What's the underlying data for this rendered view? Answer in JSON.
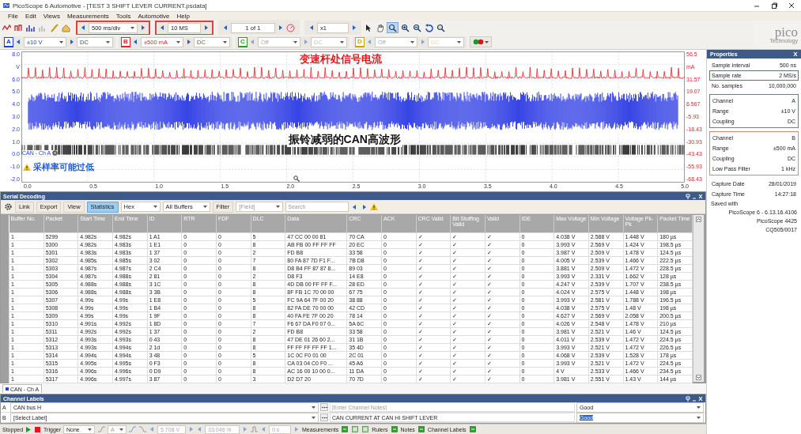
{
  "window": {
    "title": "PicoScope 6 Automotive - [TEST 3 SHIFT LEVER CURRENT.psdata]"
  },
  "menu": [
    "File",
    "Edit",
    "Views",
    "Measurements",
    "Tools",
    "Automotive",
    "Help"
  ],
  "toolbar": {
    "timebase": {
      "value": "500 ms/div",
      "highlighted": true
    },
    "samples": {
      "value": "10 MS",
      "highlighted": true
    },
    "buffer": {
      "value": "1 of 1",
      "highlighted": false
    },
    "zoom": {
      "value": "x1",
      "highlighted": false
    }
  },
  "logo": {
    "name": "pico",
    "tagline": "Technology"
  },
  "channels": [
    {
      "label": "A",
      "color": "#1f3fd6",
      "range": "±10 V",
      "coupling": "DC",
      "disabled": false
    },
    {
      "label": "B",
      "color": "#e0262b",
      "range": "±500 mA",
      "coupling": "DC",
      "disabled": false
    },
    {
      "label": "C",
      "color": "#2a9d2a",
      "range": "Off",
      "coupling": "DC",
      "disabled": true
    },
    {
      "label": "D",
      "color": "#c8a800",
      "range": "Off",
      "coupling": "DC",
      "disabled": true
    }
  ],
  "chart": {
    "left_axis": [
      "8.0",
      "V",
      "6.0",
      "5.0",
      "4.0",
      "3.0",
      "2.0",
      "1.0",
      "0.0",
      "-1.0",
      "-2.0"
    ],
    "right_axis": [
      "56.5",
      "mA",
      "31.57",
      "19.07",
      "6.567",
      "-5.93",
      "-18.43",
      "-30.93",
      "-43.43",
      "-55.93",
      "-68.43"
    ],
    "x_axis": [
      "0.0",
      "0.5",
      "1.0",
      "1.5",
      "2.0",
      "2.5",
      "3.0",
      "3.5",
      "4.0",
      "4.5",
      "5.0"
    ],
    "annotations": [
      {
        "kind": "current",
        "text": "变速杆处信号电流"
      },
      {
        "kind": "can-high",
        "text": "振铃减弱的CAN高波形"
      },
      {
        "kind": "warning",
        "text": "采样率可能过低"
      }
    ],
    "decoder_label": "CAN - Ch A"
  },
  "properties": {
    "title": "Properties",
    "general": [
      {
        "label": "Sample interval",
        "value": "500 ns",
        "highlighted": false
      },
      {
        "label": "Sample rate",
        "value": "2 MS/s",
        "highlighted": true
      },
      {
        "label": "No. samples",
        "value": "10,000,000",
        "highlighted": false
      }
    ],
    "channel_groups": [
      {
        "color": "#6b6bf0",
        "rows": [
          {
            "label": "Channel",
            "value": "A"
          },
          {
            "label": "Range",
            "value": "±10 V"
          },
          {
            "label": "Coupling",
            "value": "DC"
          }
        ]
      },
      {
        "color": "#f08080",
        "rows": [
          {
            "label": "Channel",
            "value": "B"
          },
          {
            "label": "Range",
            "value": "±500 mA"
          },
          {
            "label": "Coupling",
            "value": "DC"
          },
          {
            "label": "Low Pass Filter",
            "value": "1 kHz"
          }
        ]
      }
    ],
    "capture": [
      {
        "label": "Capture Date",
        "value": "28/01/2019"
      },
      {
        "label": "Capture Time",
        "value": "14:27:18"
      }
    ],
    "saved_with_label": "Saved with",
    "saved_with": [
      "PicoScope 6 - 6.13.16.4106",
      "PicoScope 4425",
      "CQ505/0017"
    ]
  },
  "serial_decoding": {
    "title": "Serial Decoding",
    "buttons": [
      {
        "label": "Link",
        "selected": false
      },
      {
        "label": "Export",
        "selected": false
      },
      {
        "label": "View",
        "selected": false
      },
      {
        "label": "Statistics",
        "selected": true
      }
    ],
    "format": "Hex",
    "buffers": "All Buffers",
    "filter": "Filter",
    "field_placeholder": "[Field]",
    "search_placeholder": "Search",
    "columns": [
      "Buffer No.",
      "Packet",
      "Start Time",
      "End Time",
      "ID",
      "RTR",
      "FDF",
      "DLC",
      "Data",
      "CRC",
      "ACK",
      "CRC Valid",
      "Bit Stuffing Valid",
      "Valid",
      "IDE",
      "Max Voltage",
      "Min Voltage",
      "Voltage Pk-Pk",
      "Packet Time"
    ],
    "rows": [
      {
        "cells": [
          "1",
          "5299",
          "4.982s",
          "4.982s",
          "1 A1",
          "0",
          "0",
          "5",
          "47 CC 00 00 81",
          "70 CA",
          "0",
          "✓",
          "✓",
          "✓",
          "0",
          "4.038 V",
          "2.588 V",
          "1.448 V",
          "180 µs"
        ]
      },
      {
        "cells": [
          "1",
          "5300",
          "4.982s",
          "4.983s",
          "1 E1",
          "0",
          "0",
          "8",
          "AB FB 00 FF FF FF",
          "20 EC",
          "0",
          "✓",
          "✓",
          "✓",
          "0",
          "3.993 V",
          "2.569 V",
          "1.424 V",
          "198.5 µs"
        ]
      },
      {
        "cells": [
          "1",
          "5301",
          "4.983s",
          "4.983s",
          "1 37",
          "0",
          "0",
          "2",
          "FD B8",
          "33 58",
          "0",
          "✓",
          "✓",
          "✓",
          "0",
          "3.987 V",
          "2.509 V",
          "1.478 V",
          "124.5 µs"
        ]
      },
      {
        "cells": [
          "1",
          "5302",
          "4.985s",
          "4.985s",
          "3 02",
          "0",
          "0",
          "7",
          "80 FA 87 7D F1 F...",
          "7B D8",
          "0",
          "✓",
          "✓",
          "✓",
          "0",
          "4.005 V",
          "2.539 V",
          "1.466 V",
          "222.5 µs"
        ]
      },
      {
        "cells": [
          "1",
          "5303",
          "4.987s",
          "4.987s",
          "2 C4",
          "0",
          "0",
          "8",
          "D8 B4 FF 87 87 8...",
          "89 03",
          "0",
          "✓",
          "✓",
          "✓",
          "0",
          "3.881 V",
          "2.509 V",
          "1.472 V",
          "228.5 µs"
        ]
      },
      {
        "cells": [
          "1",
          "5304",
          "4.987s",
          "4.988s",
          "2 81",
          "0",
          "0",
          "2",
          "D8 F3",
          "14 E8",
          "0",
          "✓",
          "✓",
          "✓",
          "0",
          "3.993 V",
          "2.331 V",
          "1.662 V",
          "128 µs"
        ]
      },
      {
        "cells": [
          "1",
          "5305",
          "4.988s",
          "4.988s",
          "3 1C",
          "0",
          "0",
          "8",
          "4D DB 00 FF FF F...",
          "28 ED",
          "0",
          "✓",
          "✓",
          "✓",
          "0",
          "4.247 V",
          "2.539 V",
          "1.707 V",
          "238.5 µs"
        ]
      },
      {
        "cells": [
          "1",
          "5306",
          "4.988s",
          "4.988s",
          "3 3B",
          "0",
          "0",
          "8",
          "8F FB 1C 70 00 00",
          "67 75",
          "0",
          "✓",
          "✓",
          "✓",
          "0",
          "4.024 V",
          "2.575 V",
          "1.448 V",
          "198 µs"
        ]
      },
      {
        "cells": [
          "1",
          "5307",
          "4.99s",
          "4.99s",
          "1 E8",
          "0",
          "0",
          "5",
          "FC 9A 64 7F 00 20",
          "38 88",
          "0",
          "✓",
          "✓",
          "✓",
          "0",
          "3.993 V",
          "2.581 V",
          "1.788 V",
          "196.5 µs"
        ]
      },
      {
        "cells": [
          "1",
          "5308",
          "4.99s",
          "4.99s",
          "1 B4",
          "0",
          "0",
          "8",
          "82 FA DE 70 00 00",
          "42 CD",
          "0",
          "✓",
          "✓",
          "✓",
          "0",
          "4.038 V",
          "2.575 V",
          "1.48 V",
          "198 µs"
        ]
      },
      {
        "cells": [
          "1",
          "5309",
          "4.99s",
          "4.99s",
          "1 9F",
          "0",
          "0",
          "8",
          "40 FA FE 7F 00 20",
          "78 14",
          "0",
          "✓",
          "✓",
          "✓",
          "0",
          "4.627 V",
          "2.569 V",
          "2.058 V",
          "200.5 µs"
        ]
      },
      {
        "cells": [
          "1",
          "5310",
          "4.991s",
          "4.992s",
          "1 8D",
          "0",
          "0",
          "7",
          "F6 67 DA F0 07 0...",
          "5A 6C",
          "0",
          "✓",
          "✓",
          "✓",
          "0",
          "4.026 V",
          "2.548 V",
          "1.478 V",
          "210 µs"
        ]
      },
      {
        "cells": [
          "1",
          "5311",
          "4.992s",
          "4.992s",
          "1 37",
          "0",
          "0",
          "2",
          "FD B8",
          "33 58",
          "0",
          "✓",
          "✓",
          "✓",
          "0",
          "3.981 V",
          "2.521 V",
          "1.46 V",
          "124.5 µs"
        ]
      },
      {
        "cells": [
          "1",
          "5312",
          "4.993s",
          "4.993s",
          "0 43",
          "0",
          "0",
          "8",
          "47 DE 01 26 60 2...",
          "31 1B",
          "0",
          "✓",
          "✓",
          "✓",
          "0",
          "4.011 V",
          "2.539 V",
          "1.472 V",
          "224.5 µs"
        ]
      },
      {
        "cells": [
          "1",
          "5313",
          "4.993s",
          "4.994s",
          "2 1d",
          "0",
          "0",
          "8",
          "FF FF FF FF FF 1...",
          "35 4D",
          "0",
          "✓",
          "✓",
          "✓",
          "0",
          "3.993 V",
          "2.521 V",
          "1.472 V",
          "226.5 µs"
        ]
      },
      {
        "cells": [
          "1",
          "5314",
          "4.994s",
          "4.994s",
          "3 48",
          "0",
          "0",
          "5",
          "1C 0C F0 01 00",
          "2C 01",
          "0",
          "✓",
          "✓",
          "✓",
          "0",
          "4.068 V",
          "2.539 V",
          "1.528 V",
          "178 µs"
        ]
      },
      {
        "cells": [
          "1",
          "5315",
          "4.995s",
          "4.995s",
          "0 F3",
          "0",
          "0",
          "8",
          "CA 03 04 C0 F0 ...",
          "45 A6",
          "0",
          "✓",
          "✓",
          "✓",
          "0",
          "3.993 V",
          "2.521 V",
          "1.472 V",
          "224.5 µs"
        ]
      },
      {
        "cells": [
          "1",
          "5316",
          "4.996s",
          "4.996s",
          "0 D9",
          "0",
          "0",
          "8",
          "AC 16 00 10 00 0...",
          "11 DA",
          "0",
          "✓",
          "✓",
          "✓",
          "0",
          "4 V",
          "2.533 V",
          "1.466 V",
          "234.5 µs"
        ]
      },
      {
        "cells": [
          "1",
          "5317",
          "4.996s",
          "4.997s",
          "3 87",
          "0",
          "0",
          "3",
          "D2 D7 20",
          "70 7D",
          "0",
          "✓",
          "✓",
          "✓",
          "0",
          "3.981 V",
          "2.551 V",
          "1.43 V",
          "144 µs"
        ]
      }
    ]
  },
  "tabs": [
    {
      "label": "CAN - Ch A",
      "selected": true
    }
  ],
  "channel_labels": {
    "title": "Channel Labels",
    "rows": [
      {
        "channel": "A",
        "label": "CAN bus H",
        "notes_placeholder": "[Enter Channel Notes]",
        "status": "Good",
        "status_selected": false
      },
      {
        "channel": "B",
        "label": "[Select Label]",
        "notes": "CAN CURRENT AT CAN HI SHIFT LEVER",
        "status": "Good",
        "status_selected": true
      }
    ]
  },
  "status_bar": {
    "state": "Stopped",
    "trigger_label": "Trigger",
    "trigger_mode": "None",
    "trigger_disabled": true,
    "trigger_channel": "A",
    "trigger_level": "5.708 V",
    "pretrigger": "33.049 %",
    "delay": "0 s",
    "toggles": [
      "Measurements",
      "Rulers",
      "Notes",
      "Channel Labels"
    ]
  }
}
